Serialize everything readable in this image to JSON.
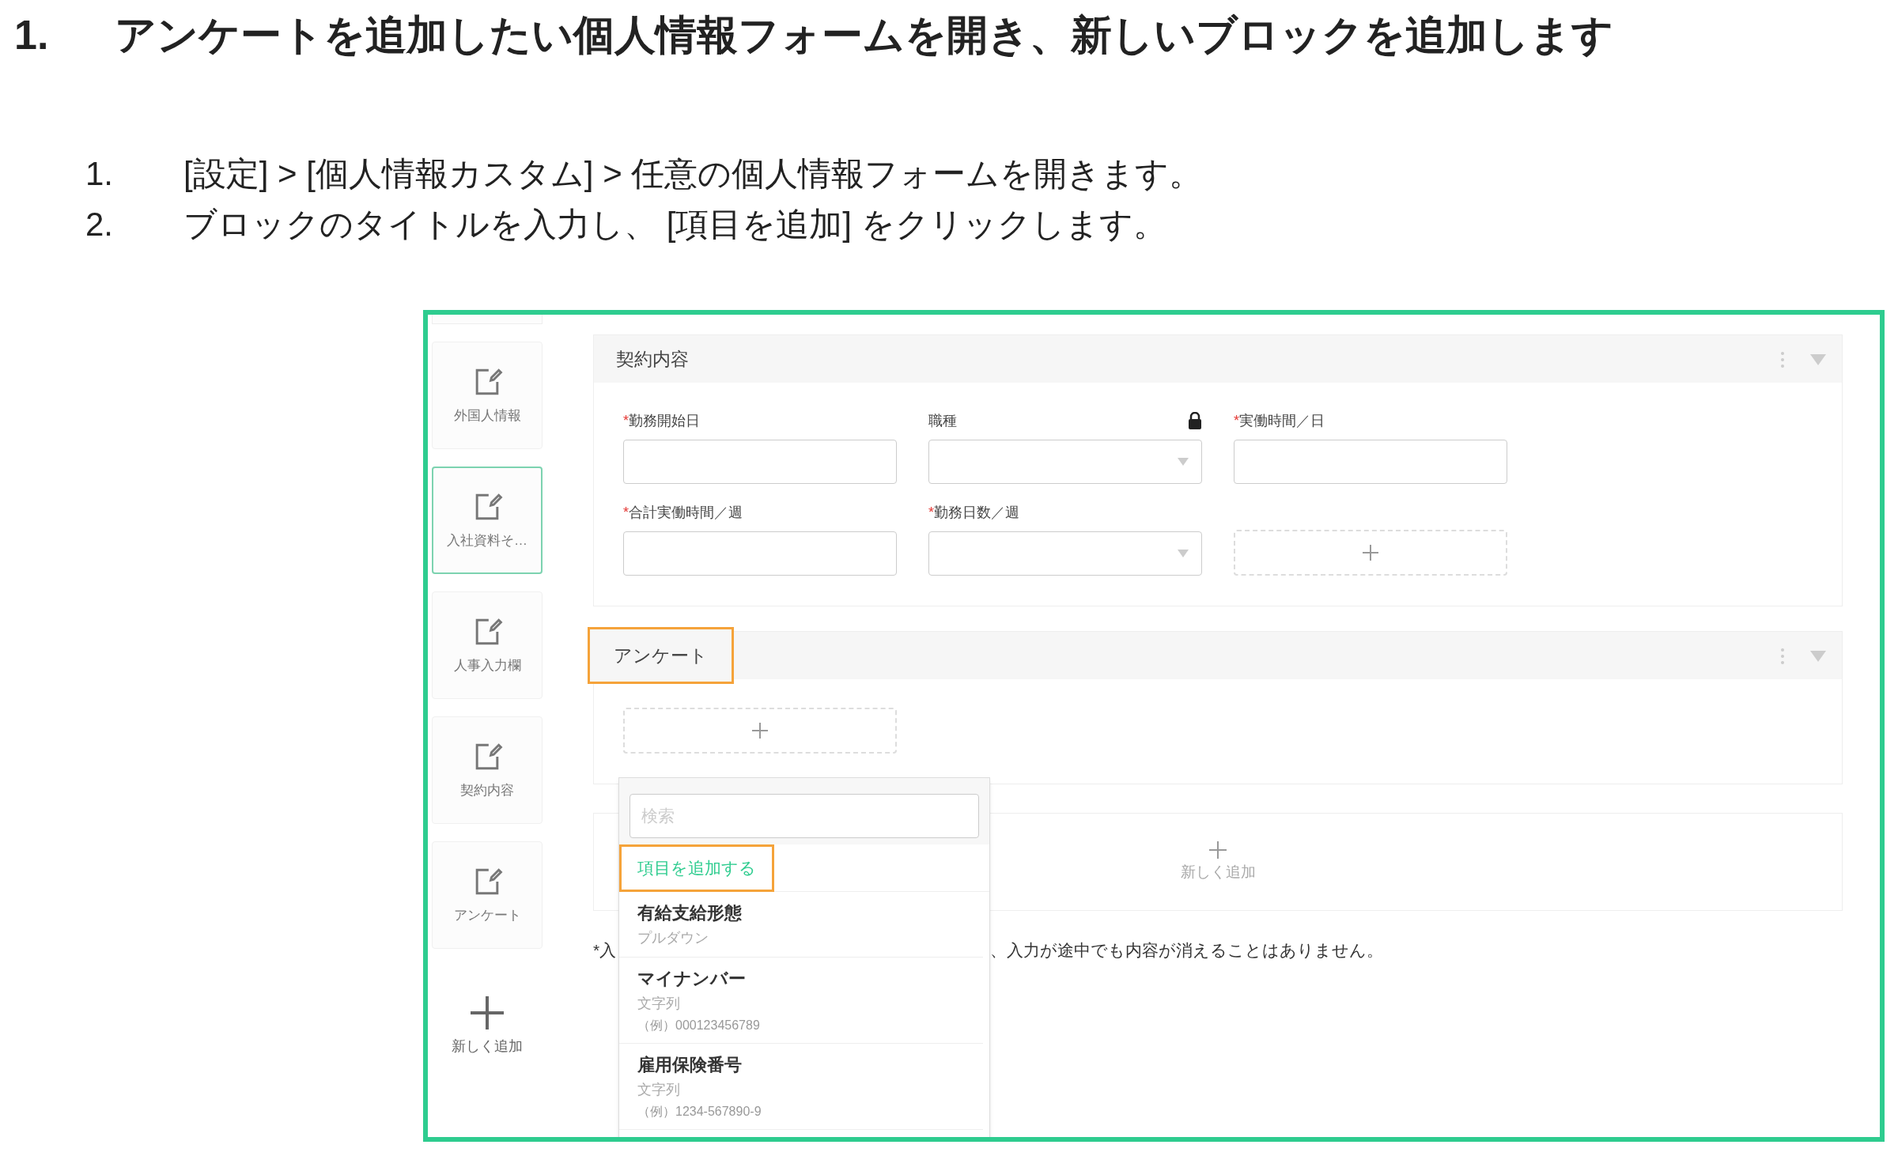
{
  "heading": {
    "number": "1.",
    "text": "アンケートを追加したい個人情報フォームを開き、新しいブロックを追加します"
  },
  "steps": [
    {
      "number": "1.",
      "text": "[設定] > [個人情報カスタム] > 任意の個人情報フォームを開きます。"
    },
    {
      "number": "2.",
      "text": "ブロックのタイトルを入力し、 [項目を追加] をクリックします。"
    }
  ],
  "screenshot": {
    "sidebar": {
      "items": [
        {
          "label": "外国人情報",
          "selected": false
        },
        {
          "label": "入社資料そ…",
          "selected": true
        },
        {
          "label": "人事入力欄",
          "selected": false
        },
        {
          "label": "契約内容",
          "selected": false
        },
        {
          "label": "アンケート",
          "selected": false
        }
      ],
      "add_label": "新しく追加"
    },
    "sections": [
      {
        "title": "契約内容",
        "highlighted": false,
        "rows": [
          [
            {
              "mark": "*",
              "label": "勤務開始日",
              "kind": "text",
              "locked": false
            },
            {
              "label": "職種",
              "kind": "select",
              "locked": true
            },
            {
              "mark": "*",
              "label": "実働時間／日",
              "kind": "text",
              "locked": false
            }
          ],
          [
            {
              "mark": "*",
              "label": "合計実働時間／週",
              "kind": "text",
              "locked": false
            },
            {
              "mark": "*",
              "label": "勤務日数／週",
              "kind": "select",
              "locked": false
            }
          ]
        ]
      },
      {
        "title": "アンケート",
        "highlighted": true
      }
    ],
    "new_block": {
      "label": "新しく追加"
    },
    "note": {
      "left": "*入",
      "right": "、入力が途中でも内容が消えることはありません。"
    },
    "dropdown": {
      "placeholder": "検索",
      "add_option": {
        "label": "項目を追加する",
        "highlighted": true
      },
      "options": [
        {
          "name": "有給支給形態",
          "type": "プルダウン"
        },
        {
          "name": "マイナンバー",
          "type": "文字列",
          "example": "（例）000123456789"
        },
        {
          "name": "雇用保険番号",
          "type": "文字列",
          "example": "（例）1234-567890-9"
        }
      ]
    }
  }
}
